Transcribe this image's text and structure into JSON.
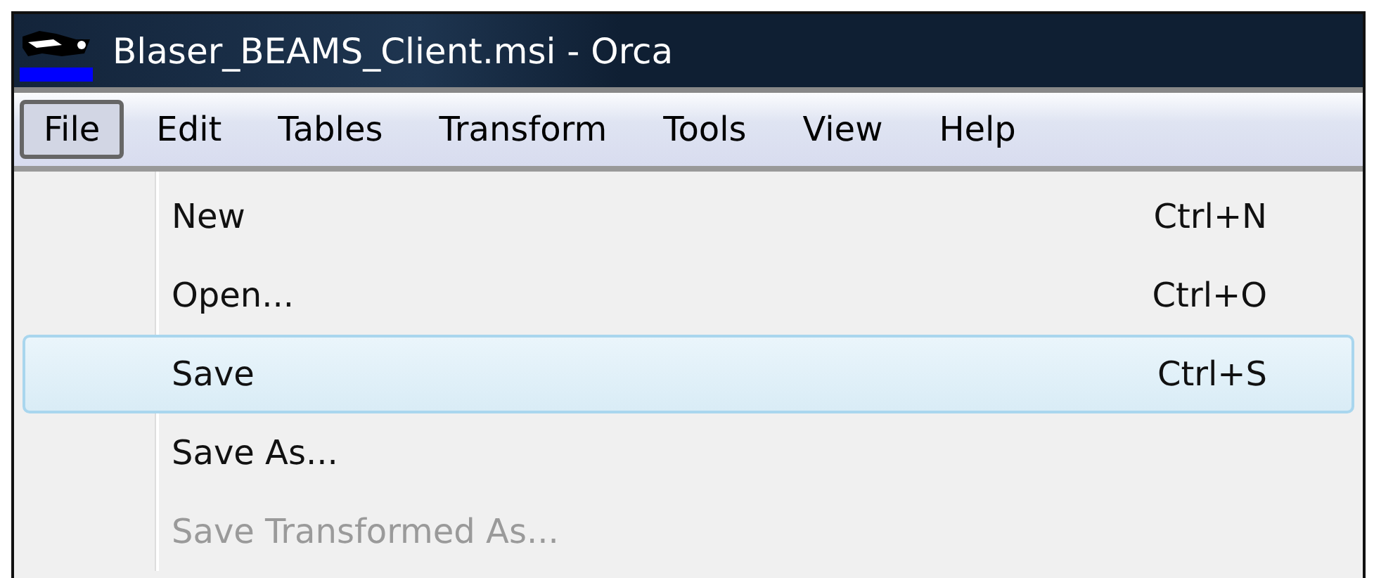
{
  "window": {
    "title": "Blaser_BEAMS_Client.msi - Orca"
  },
  "menu_bar": [
    {
      "label": "File",
      "selected": true
    },
    {
      "label": "Edit",
      "selected": false
    },
    {
      "label": "Tables",
      "selected": false
    },
    {
      "label": "Transform",
      "selected": false
    },
    {
      "label": "Tools",
      "selected": false
    },
    {
      "label": "View",
      "selected": false
    },
    {
      "label": "Help",
      "selected": false
    }
  ],
  "file_menu": [
    {
      "label": "New",
      "shortcut": "Ctrl+N",
      "selected": false,
      "disabled": false
    },
    {
      "label": "Open...",
      "shortcut": "Ctrl+O",
      "selected": false,
      "disabled": false
    },
    {
      "label": "Save",
      "shortcut": "Ctrl+S",
      "selected": true,
      "disabled": false
    },
    {
      "label": "Save As...",
      "selected": false,
      "disabled": false
    },
    {
      "label": "Save Transformed As...",
      "selected": false,
      "disabled": true
    }
  ]
}
